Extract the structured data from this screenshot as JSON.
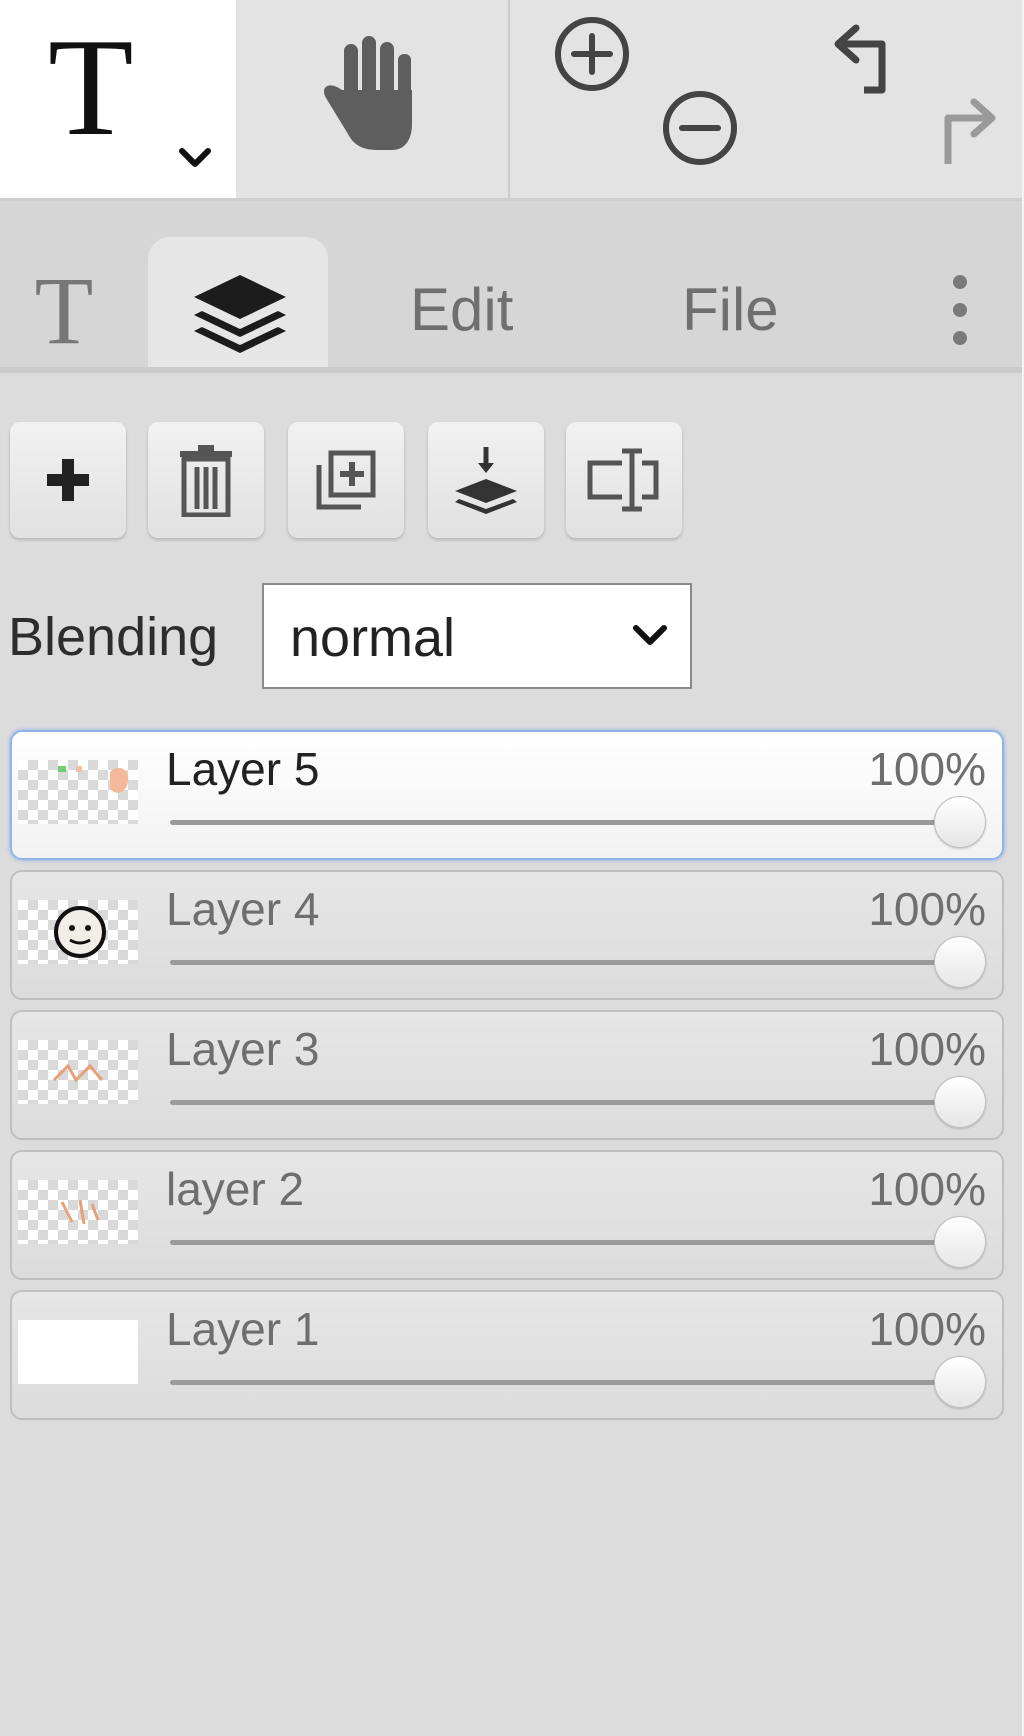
{
  "toolbar": {
    "text_tool": "T",
    "tools": [
      "text-tool",
      "hand-tool",
      "zoom-in",
      "zoom-out",
      "undo",
      "redo"
    ]
  },
  "tabs": {
    "text_tab": "T",
    "layers_tab_icon": "layers-icon",
    "edit": "Edit",
    "file": "File",
    "more_icon": "more-vertical-icon"
  },
  "layer_actions": [
    "add-layer",
    "delete-layer",
    "duplicate-layer",
    "merge-down",
    "rename-layer"
  ],
  "blending": {
    "label": "Blending",
    "value": "normal"
  },
  "layers": [
    {
      "name": "Layer 5",
      "opacity": "100%",
      "opacity_value": 100,
      "active": true
    },
    {
      "name": "Layer 4",
      "opacity": "100%",
      "opacity_value": 100,
      "active": false
    },
    {
      "name": "Layer 3",
      "opacity": "100%",
      "opacity_value": 100,
      "active": false
    },
    {
      "name": "layer 2",
      "opacity": "100%",
      "opacity_value": 100,
      "active": false
    },
    {
      "name": "Layer 1",
      "opacity": "100%",
      "opacity_value": 100,
      "active": false
    }
  ],
  "colors": {
    "active_border": "#8fb4ea",
    "panel_bg": "#dcdcdc"
  }
}
